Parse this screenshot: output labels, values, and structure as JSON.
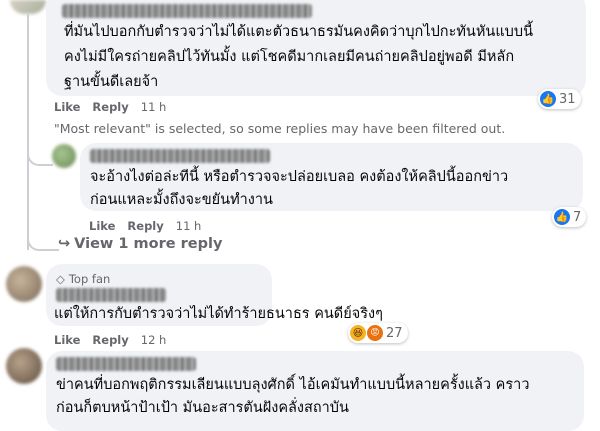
{
  "comments": [
    {
      "id": "c1",
      "lines": [
        "ที่มันไปบอกกับตำรวจว่าไม่ได้แตะตัวธนาธรมันคงคิดว่าบุกไปกะทันหันแบบนี้",
        "คงไม่มีใครถ่ายคลิปไว้ทันมั้ง แต่โชคดีมากเลยมีคนถ่ายคลิปอยู่พอดี มีหลัก",
        "ฐานขั้นดีเลยจ้า"
      ],
      "like_label": "Like",
      "reply_label": "Reply",
      "time": "11 h",
      "reaction_count": "31",
      "reaction_icons": [
        "like-icon"
      ]
    },
    {
      "id": "c2",
      "lines": [
        "จะอ้างไงต่อล่ะทีนี้  หรือตำรวจจะปล่อยเบลอ คงต้องให้คลิปนี้ออกข่าว",
        "ก่อนแหละมั้งถึงจะขยันทำงาน"
      ],
      "like_label": "Like",
      "reply_label": "Reply",
      "time": "11 h",
      "reaction_count": "7",
      "reaction_icons": [
        "like-icon"
      ]
    },
    {
      "id": "c3",
      "badge": "Top fan",
      "lines": [
        "แต่ให้การกับตำรวจว่าไม่ได้ทำร้ายธนาธร คนดีย์จริงๆ"
      ],
      "like_label": "Like",
      "reply_label": "Reply",
      "time": "12 h",
      "reaction_count": "27",
      "reaction_icons": [
        "haha-icon",
        "angry-icon"
      ]
    },
    {
      "id": "c4",
      "lines": [
        "ข่าคนที่บอกพฤติกรรมเลียนแบบลุงศักดิ์ ไอ้เคมันทำแบบนี้หลายครั้งแล้ว คราว",
        "ก่อนก็ตบหน้าป้าเป้า มันอะสารตันฝังคลั่งสถาบัน"
      ]
    }
  ],
  "notice": "\"Most relevant\" is selected, so some replies may have been filtered out.",
  "view_more": "View 1 more reply",
  "colors": {
    "bubble": "#f0f2f5",
    "meta": "#65676b",
    "like_blue": "#1877f2",
    "thread": "#ccd0d5"
  }
}
